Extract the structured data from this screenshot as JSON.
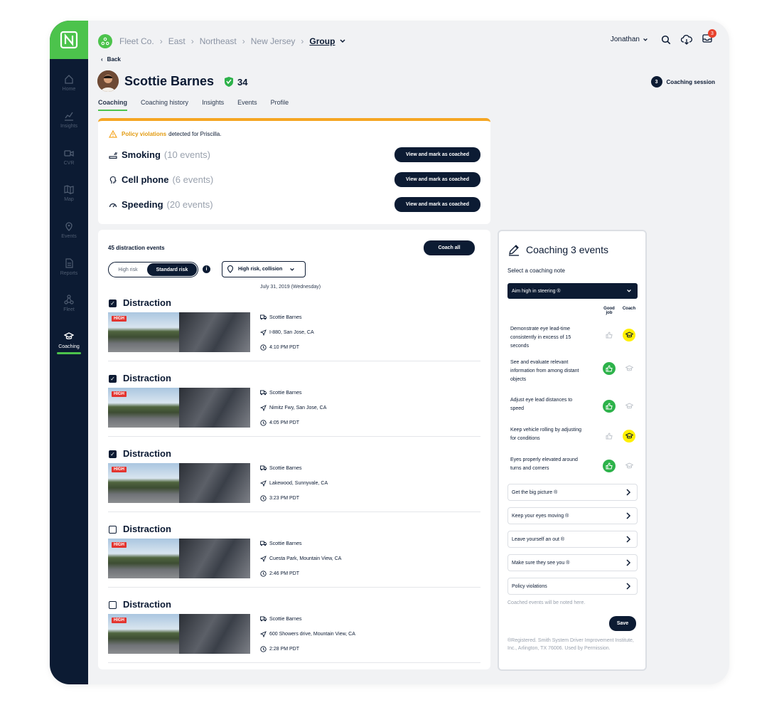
{
  "sidebar": {
    "items": [
      {
        "label": "Home"
      },
      {
        "label": "Insights"
      },
      {
        "label": "CVR"
      },
      {
        "label": "Map"
      },
      {
        "label": "Events"
      },
      {
        "label": "Reports"
      },
      {
        "label": "Fleet"
      },
      {
        "label": "Coaching"
      }
    ]
  },
  "breadcrumb": [
    "Fleet Co.",
    "East",
    "Northeast",
    "New Jersey",
    "Group"
  ],
  "user": {
    "name": "Jonathan",
    "notifications": "3"
  },
  "back": "Back",
  "driver": {
    "name": "Scottie Barnes",
    "score": "34"
  },
  "session": {
    "num": "3",
    "label": "Coaching session"
  },
  "tabs": [
    "Coaching",
    "Coaching history",
    "Insights",
    "Events",
    "Profile"
  ],
  "policy": {
    "highlight": "Policy violations",
    "rest": "detected for Priscilla.",
    "button": "View and mark as coached",
    "rows": [
      {
        "label": "Smoking",
        "count": "(10 events)"
      },
      {
        "label": "Cell phone",
        "count": "(6 events)"
      },
      {
        "label": "Speeding",
        "count": "(20 events)"
      }
    ]
  },
  "events": {
    "heading": "45 distraction events",
    "coach_all": "Coach all",
    "toggle": [
      "High risk",
      "Standard risk"
    ],
    "filter": "High risk, collision",
    "date": "July 31, 2019 (Wednesday)",
    "items": [
      {
        "title": "Distraction",
        "checked": true,
        "badge": "HIGH",
        "driver": "Scottie Barnes",
        "location": "I-880, San Jose, CA",
        "time": "4:10 PM PDT"
      },
      {
        "title": "Distraction",
        "checked": true,
        "badge": "HIGH",
        "driver": "Scottie Barnes",
        "location": "Nimitz Fwy, San Jose, CA",
        "time": "4:05 PM PDT"
      },
      {
        "title": "Distraction",
        "checked": true,
        "badge": "HIGH",
        "driver": "Scottie Barnes",
        "location": "Lakewood, Sunnyvale, CA",
        "time": "3:23 PM PDT"
      },
      {
        "title": "Distraction",
        "checked": false,
        "badge": "HIGH",
        "driver": "Scottie Barnes",
        "location": "Cuesta Park, Mountain View, CA",
        "time": "2:46 PM PDT"
      },
      {
        "title": "Distraction",
        "checked": false,
        "badge": "HIGH",
        "driver": "Scottie Barnes",
        "location": "600 Showers drive, Mountain View, CA",
        "time": "2:28 PM PDT"
      }
    ]
  },
  "coaching": {
    "title": "Coaching 3 events",
    "subtitle": "Select a coaching note",
    "selected": "Aim high in steering ®",
    "col_good": "Good job",
    "col_coach": "Coach",
    "skills": [
      {
        "text": "Demonstrate eye lead-time consistently in excess of 15 seconds",
        "state": "coach"
      },
      {
        "text": "See and evaluate relevant information from among distant objects",
        "state": "good"
      },
      {
        "text": "Adjust eye lead distances to speed",
        "state": "good"
      },
      {
        "text": "Keep vehicle rolling by adjusting for conditions",
        "state": "coach"
      },
      {
        "text": "Eyes properly elevated around turns and corners",
        "state": "good"
      }
    ],
    "notes": [
      "Get the big picture ®",
      "Keep your eyes moving ®",
      "Leave yourself an out ®",
      "Make sure they see you ®",
      "Policy violations"
    ],
    "footer": "Coached events will be noted here.",
    "save": "Save",
    "legal": "®Registered. Smith System Driver Improvement Institute, Inc., Arlington, TX 76006. Used by Permission."
  }
}
